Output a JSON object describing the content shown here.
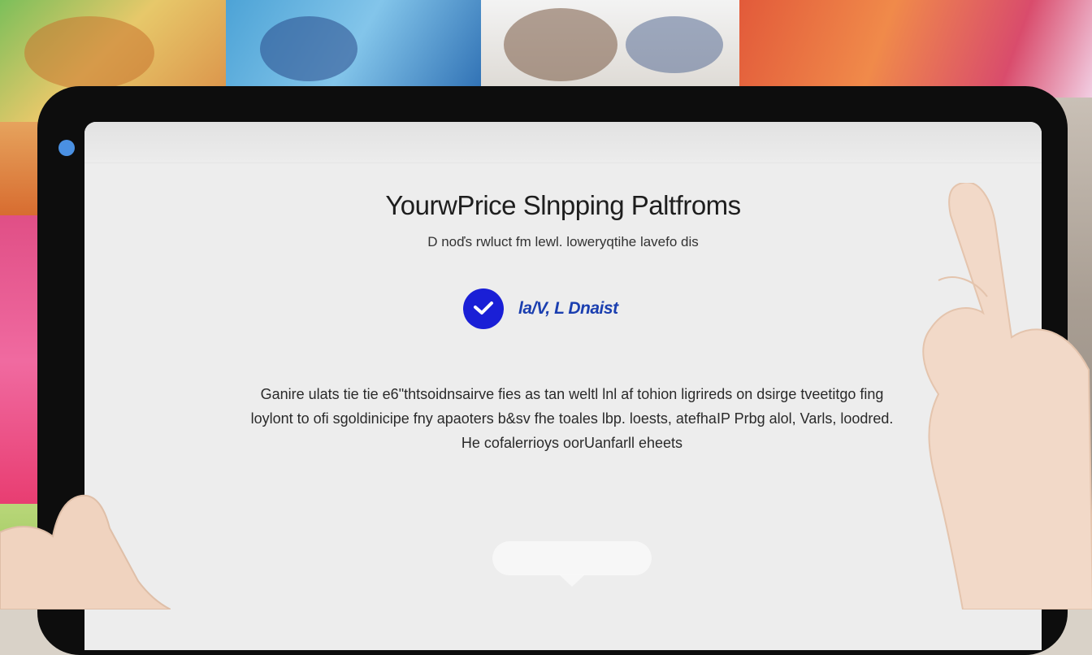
{
  "screen": {
    "title": "YourwPrice Slnpping Paltfroms",
    "subtitle": "D noďs rwluct fm lewl. loweryqtihe lavefo dis",
    "badge": {
      "icon": "checkmark-circle-icon",
      "text": "la/V, L Dnaist",
      "color": "#1a1fd6"
    },
    "body_lines": [
      "Ganire ulats tie tie e6\"thtsoidnsairve fies as tan weltl lnl af tohion ligrireds on dsirge tveetitgo fing",
      "loylont to ofi sgoldinicipe fny apaoters b&sv fhe toales lbp. loests, atefhaIP Prbg alol, Varls, loodred.",
      "He cofalerrioys oorUanfarll eheets"
    ]
  },
  "colors": {
    "accent": "#1a1fd6",
    "camera": "#4a90e2",
    "bezel": "#0d0d0d",
    "screen_bg": "#ededed"
  }
}
